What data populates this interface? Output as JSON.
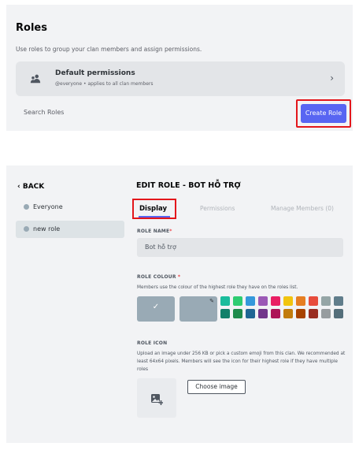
{
  "roles_panel": {
    "title": "Roles",
    "description": "Use roles to group your clan members and assign permissions.",
    "default_permissions": {
      "title": "Default permissions",
      "subtitle": "@everyone • applies to all clan members",
      "icon": "users-icon"
    },
    "search_placeholder": "Search Roles",
    "create_button": "Create Role"
  },
  "edit_panel": {
    "back_label": "BACK",
    "roles": [
      {
        "name": "Everyone",
        "active": false
      },
      {
        "name": "new role",
        "active": true
      }
    ],
    "title": "EDIT ROLE - BOT HỖ TRỢ",
    "tabs": [
      "Display",
      "Permissions",
      "Manage Members (0)"
    ],
    "active_tab": "Display",
    "role_name_label": "ROLE NAME",
    "role_name_value": "Bot hỗ trợ",
    "role_colour_label": "ROLE COLOUR",
    "role_colour_help": "Members use the colour of the highest role they have on the roles list.",
    "role_icon_label": "ROLE ICON",
    "role_icon_help": "Upload an image under 256 KB or pick a custom emoji from this clan. We recommended at least 64x64 pixels. Members will see the icon for their highest role if they have multiple roles",
    "choose_image_button": "Choose image",
    "colors": {
      "accent": "#5865f2",
      "highlight": "#e3161b",
      "default_role": "#99aab5"
    },
    "swatches_row1": [
      "#1abc9c",
      "#2ecc71",
      "#3498db",
      "#9b59b6",
      "#e91e63",
      "#f1c40f",
      "#e67e22",
      "#e74c3c",
      "#95a5a6",
      "#607d8b"
    ],
    "swatches_row2": [
      "#11806a",
      "#1f8b4c",
      "#206694",
      "#71368a",
      "#ad1457",
      "#c27c0e",
      "#a84300",
      "#992d22",
      "#979c9f",
      "#546e7a"
    ]
  }
}
